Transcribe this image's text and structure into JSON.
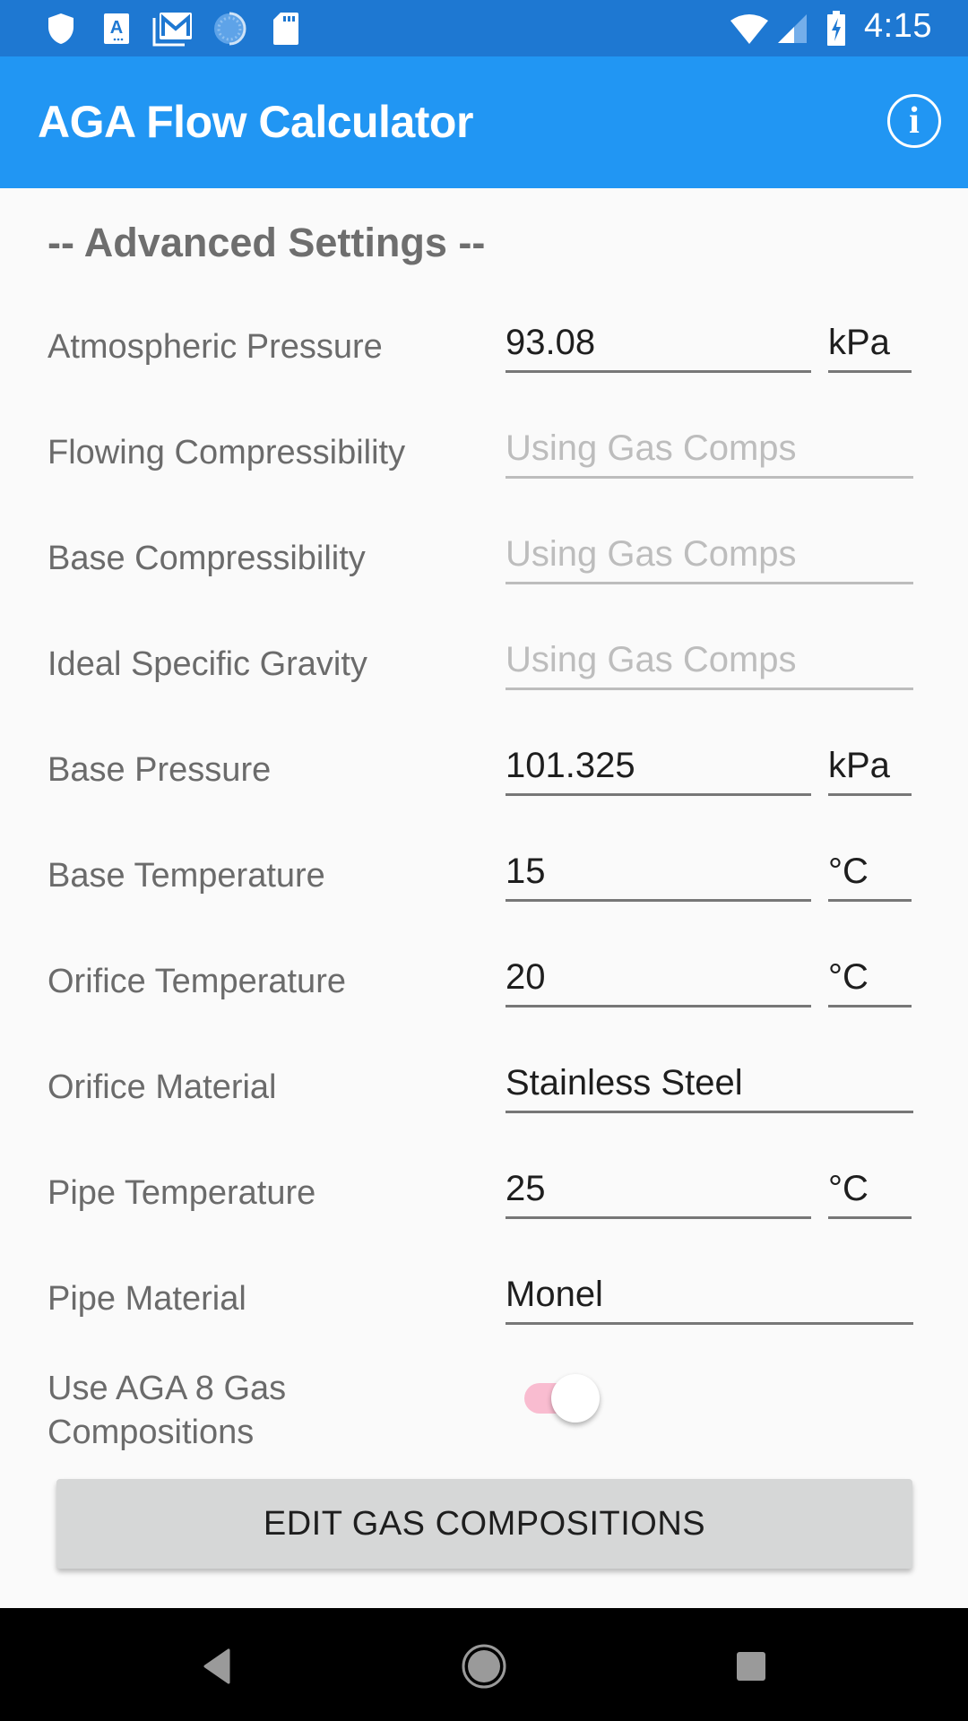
{
  "status_bar": {
    "time": "4:15",
    "left_icons": [
      "shield-icon",
      "keyboard-a-icon",
      "gmail-icon",
      "sync-progress-icon",
      "sd-card-icon"
    ],
    "right_icons": [
      "wifi-icon",
      "cell-signal-icon",
      "battery-charging-icon"
    ]
  },
  "app_bar": {
    "title": "AGA Flow Calculator",
    "info_icon": "i"
  },
  "section_title": "-- Advanced Settings --",
  "rows": [
    {
      "label": "Atmospheric Pressure",
      "value": "93.08",
      "unit": "kPa"
    },
    {
      "label": "Flowing Compressibility",
      "placeholder": "Using Gas Comps"
    },
    {
      "label": "Base Compressibility",
      "placeholder": "Using Gas Comps"
    },
    {
      "label": "Ideal Specific Gravity",
      "placeholder": "Using Gas Comps"
    },
    {
      "label": "Base Pressure",
      "value": "101.325",
      "unit": "kPa"
    },
    {
      "label": "Base Temperature",
      "value": "15",
      "unit": "°C"
    },
    {
      "label": "Orifice Temperature",
      "value": "20",
      "unit": "°C"
    },
    {
      "label": "Orifice Material",
      "value": "Stainless Steel"
    },
    {
      "label": "Pipe Temperature",
      "value": "25",
      "unit": "°C"
    },
    {
      "label": "Pipe Material",
      "value": "Monel"
    }
  ],
  "toggle": {
    "label_line1": "Use AGA 8 Gas",
    "label_line2": "Compositions",
    "state": "on",
    "accent_color": "#f9bcd0"
  },
  "edit_button": "EDIT GAS COMPOSITIONS",
  "nav_bar": {
    "back": "back-icon",
    "home": "home-icon",
    "recents": "recents-icon"
  },
  "colors": {
    "status_bar": "#1e78d2",
    "app_bar": "#2196f3",
    "background": "#fafafa"
  }
}
